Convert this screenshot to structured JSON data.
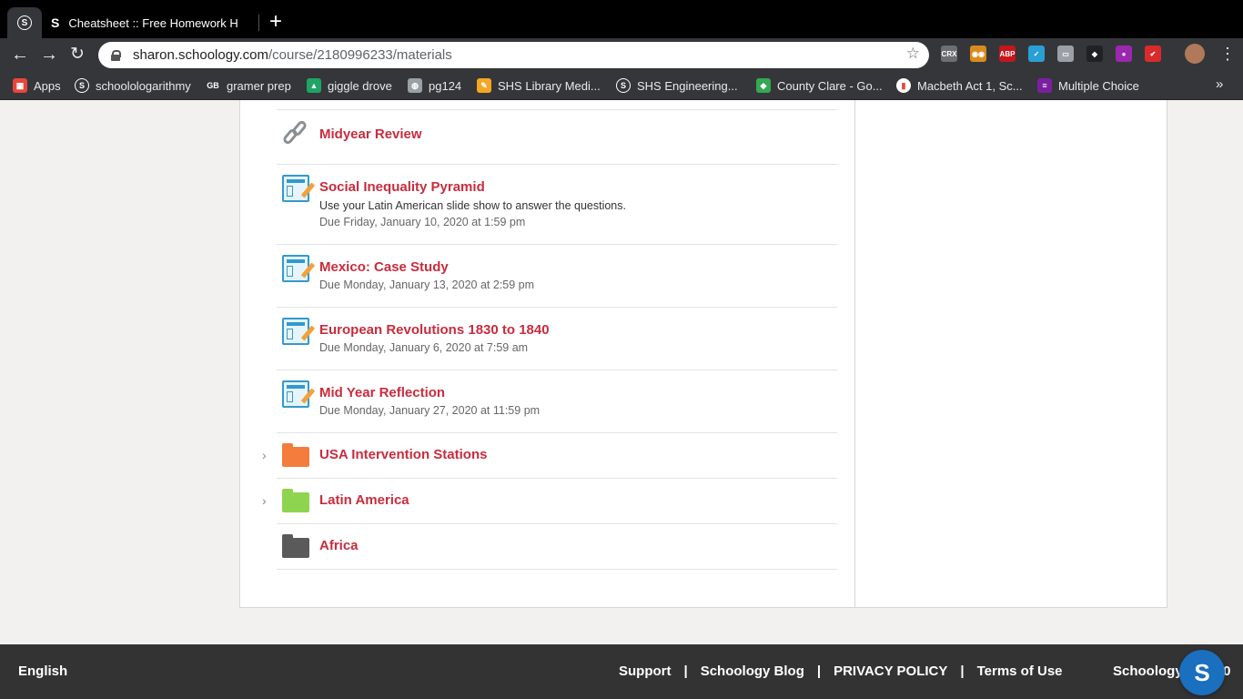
{
  "browser": {
    "tab_title": "Cheatsheet :: Free Homework H",
    "tab_favicon": "S",
    "pinned_favicon": "S",
    "url_host": "sharon.schoology.com",
    "url_path": "/course/2180996233/materials",
    "extensions": [
      {
        "name": "crx-extension-icon",
        "text": "CRX",
        "color": "#6b6f73"
      },
      {
        "name": "owl-extension-icon",
        "text": "◉◉",
        "color": "#d98b1e"
      },
      {
        "name": "adblock-plus-icon",
        "text": "ABP",
        "color": "#c4161c"
      },
      {
        "name": "chart-extension-icon",
        "text": "✓",
        "color": "#2a9fd6"
      },
      {
        "name": "briefcase-extension-icon",
        "text": "▭",
        "color": "#9aa0a6"
      },
      {
        "name": "dark-extension-icon",
        "text": "◆",
        "color": "#202124"
      },
      {
        "name": "colorful-extension-icon",
        "text": "●",
        "color": "#9c27b0"
      },
      {
        "name": "red-check-extension-icon",
        "text": "✔",
        "color": "#d92b2b"
      }
    ]
  },
  "bookmarks": [
    {
      "label": "Apps",
      "icon": "apps-grid-icon",
      "color": "#e8453c"
    },
    {
      "label": "schoolologarithmy",
      "icon": "schoology-icon",
      "color": "#35363a"
    },
    {
      "label": "gramer prep",
      "icon": "gb-icon",
      "color": "#35363a"
    },
    {
      "label": "giggle drove",
      "icon": "google-drive-icon",
      "color": "#1fa463"
    },
    {
      "label": "pg124",
      "icon": "globe-icon",
      "color": "#9aa0a6"
    },
    {
      "label": "SHS Library Medi...",
      "icon": "library-icon",
      "color": "#f5a623"
    },
    {
      "label": "SHS Engineering...",
      "icon": "schoology-icon",
      "color": "#35363a"
    },
    {
      "label": "County Clare - Go...",
      "icon": "maps-icon",
      "color": "#34a853"
    },
    {
      "label": "Macbeth Act 1, Sc...",
      "icon": "chart-icon",
      "color": "#ffffff"
    },
    {
      "label": "Multiple Choice",
      "icon": "list-icon",
      "color": "#7b1fa2"
    }
  ],
  "materials": {
    "items": [
      {
        "type": "link",
        "title": "Midyear Review"
      },
      {
        "type": "assignment",
        "title": "Social Inequality Pyramid",
        "description": "Use your Latin American slide show to answer the questions.",
        "due": "Due Friday, January 10, 2020 at 1:59 pm"
      },
      {
        "type": "assignment",
        "title": "Mexico: Case Study",
        "due": "Due Monday, January 13, 2020 at 2:59 pm"
      },
      {
        "type": "assignment",
        "title": "European Revolutions 1830 to 1840",
        "due": "Due Monday, January 6, 2020 at 7:59 am"
      },
      {
        "type": "assignment",
        "title": "Mid Year Reflection",
        "due": "Due Monday, January 27, 2020 at 11:59 pm"
      },
      {
        "type": "folder",
        "title": "USA Intervention Stations",
        "color": "#f47c3c",
        "expandable": true
      },
      {
        "type": "folder",
        "title": "Latin America",
        "color": "#8fd44f",
        "expandable": true
      },
      {
        "type": "folder",
        "title": "Africa",
        "color": "#5a5a5a",
        "expandable": false
      }
    ]
  },
  "footer": {
    "language": "English",
    "links": [
      "Support",
      "Schoology Blog",
      "PRIVACY POLICY",
      "Terms of Use"
    ],
    "separator": "|",
    "brand": "Schoology © 2020",
    "badge": "S"
  }
}
